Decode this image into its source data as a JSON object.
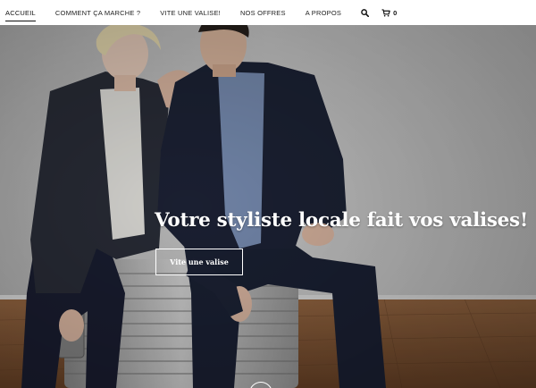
{
  "nav": {
    "items": [
      {
        "label": "ACCUEIL",
        "active": true
      },
      {
        "label": "COMMENT ÇA MARCHE ?",
        "active": false
      },
      {
        "label": "VITE UNE VALISE!",
        "active": false
      },
      {
        "label": "NOS OFFRES",
        "active": false
      },
      {
        "label": "A PROPOS",
        "active": false
      }
    ],
    "search_icon": "search-icon",
    "cart_icon": "cart-icon",
    "cart_count": "0"
  },
  "hero": {
    "headline": "Votre styliste locale fait vos valises!",
    "cta_label": "Vite une valise",
    "scroll_icon": "chevron-down-icon"
  },
  "colors": {
    "nav_bg": "#ffffff",
    "text_dark": "#222222",
    "hero_text": "#ffffff"
  }
}
